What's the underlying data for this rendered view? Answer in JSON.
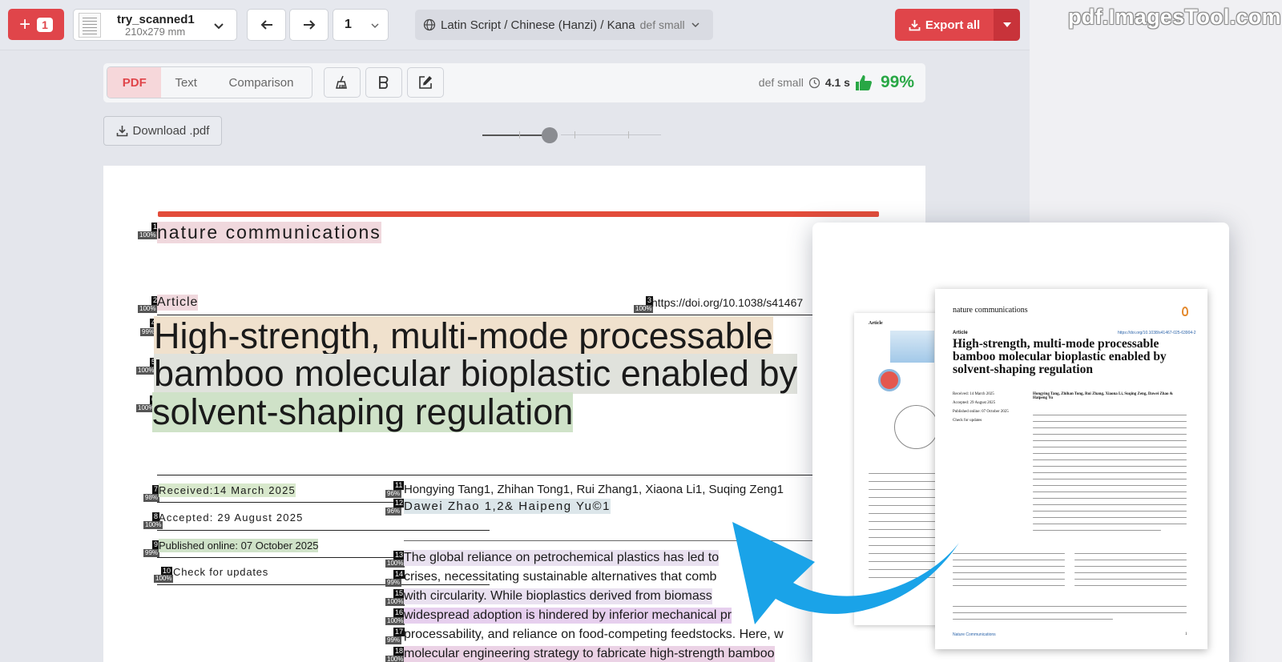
{
  "topbar": {
    "add_count": "1",
    "file_name": "try_scanned1",
    "file_size": "210x279 mm",
    "page_number": "1",
    "language": "Latin Script / Chinese (Hanzi) / Kana",
    "language_model": "def small",
    "export_label": "Export all"
  },
  "watermark": "pdf.ImagesTool.com",
  "subbar": {
    "tabs": [
      "PDF",
      "Text",
      "Comparison"
    ],
    "active_tab": "PDF",
    "model": "def small",
    "time": "4.1 s",
    "score": "99%"
  },
  "download_label": "Download .pdf",
  "zoom_fraction": 0.38,
  "document": {
    "journal": "nature communications",
    "article": "Article",
    "doi": "https://doi.org/10.1038/s41467",
    "title_lines": [
      "High-strength, multi-mode processable",
      "bamboo molecular bioplastic enabled by",
      "solvent-shaping regulation"
    ],
    "received": "Received:14 March 2025",
    "accepted": "Accepted: 29 August 2025",
    "published": "Published online: 07 October 2025",
    "check_updates": "Check for updates",
    "authors_1": "Hongying Tang1, Zhihan Tong1, Rui Zhang1, Xiaona Li1, Suqing Zeng1",
    "authors_2": "Dawei Zhao 1,2& Haipeng Yu©1",
    "abstract_lines": [
      "The global reliance on petrochemical plastics has led to",
      "crises, necessitating sustainable alternatives that comb",
      "with circularity. While bioplastics derived from biomass",
      "widespread adoption is hindered by inferior mechanical pr",
      "processability, and reliance on food-competing feedstocks. Here, w",
      "molecular engineering strategy to fabricate high-strength bamboo"
    ],
    "markers": {
      "b1": {
        "n": "1",
        "p": "100%"
      },
      "b2": {
        "n": "2",
        "p": "100%"
      },
      "b3": {
        "n": "3",
        "p": "100%"
      },
      "b4": {
        "n": "4",
        "p": "99%"
      },
      "b5": {
        "n": "5",
        "p": "100%"
      },
      "b6": {
        "n": "6",
        "p": "100%"
      },
      "b7": {
        "n": "7",
        "p": "98%"
      },
      "b8": {
        "n": "8",
        "p": "100%"
      },
      "b9": {
        "n": "9",
        "p": "99%"
      },
      "b10": {
        "n": "10",
        "p": "100%"
      },
      "b11": {
        "n": "11",
        "p": "96%"
      },
      "b12": {
        "n": "12",
        "p": "96%"
      },
      "b13": {
        "n": "13",
        "p": "100%"
      },
      "b14": {
        "n": "14",
        "p": "99%"
      },
      "b15": {
        "n": "15",
        "p": "100%"
      },
      "b16": {
        "n": "16",
        "p": "100%"
      },
      "b17": {
        "n": "17",
        "p": "99%"
      },
      "b18": {
        "n": "18",
        "p": "100%"
      }
    }
  },
  "preview": {
    "journal": "nature communications",
    "article": "Article",
    "doi": "https://doi.org/10.1038/s41467-025-63904-2",
    "title_lines": [
      "High-strength, multi-mode processable",
      "bamboo molecular bioplastic enabled by",
      "solvent-shaping regulation"
    ],
    "received": "Received: 14 March 2025",
    "accepted": "Accepted: 29 August 2025",
    "published": "Published online: 07 October 2025",
    "check_updates": "Check for updates",
    "authors": "Hongying Tang, Zhihan Tong, Rui Zhang, Xiaona Li, Suqing Zeng, Dawei Zhao & Haipeng Yu",
    "footer": "Nature Communications",
    "page": "1",
    "back_label": "Article"
  }
}
